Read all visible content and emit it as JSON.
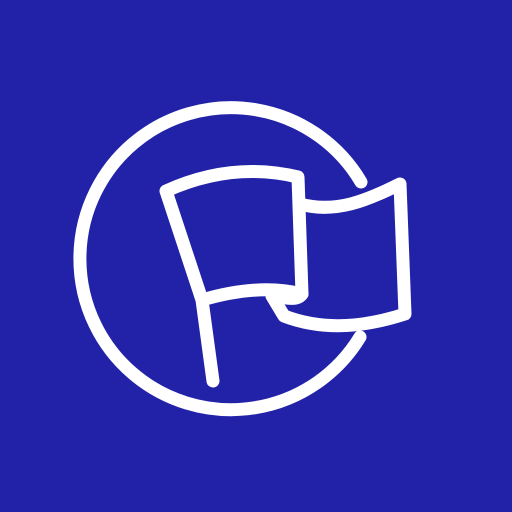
{
  "icon": {
    "name": "flag-in-circle-icon",
    "background_color": "#2222a8",
    "foreground_color": "#ffffff"
  }
}
